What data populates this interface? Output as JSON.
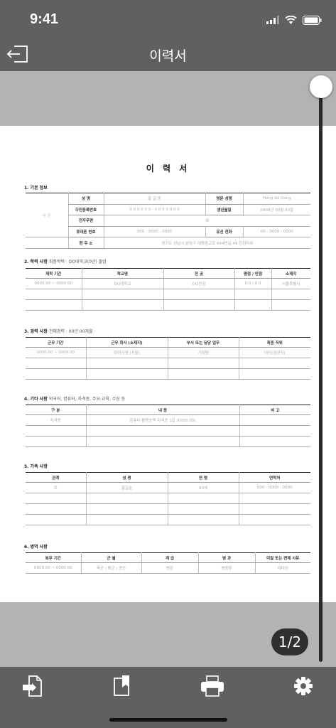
{
  "status": {
    "time": "9:41"
  },
  "nav": {
    "title": "이력서"
  },
  "doc": {
    "title": "이 력 서",
    "basic": {
      "heading": "1. 기본 정보",
      "photo": "사 진",
      "rows": [
        {
          "l1": "성 명",
          "v1": "홍 길 동",
          "l2": "영문 성명",
          "v2": "Hong Gil Dong"
        },
        {
          "l1": "주민등록번호",
          "v1": "0 0 0 0 0 0 - 0 0 0 0 0 0 0",
          "l2": "생년월일",
          "v2": "0000년 00월 00일"
        },
        {
          "l1": "전자우편",
          "v1": "@",
          "l2": "",
          "v2": ""
        },
        {
          "l1": "휴대폰 번호",
          "v1": "000 - 0000 - 0000",
          "l2": "유선 전화",
          "v2": "00 - 0000 - 0000"
        },
        {
          "l1": "현 주 소",
          "v1": "경기도 성남시 분당구 대왕판교로 644번길 49 한컴타워",
          "l2": "",
          "v2": ""
        }
      ]
    },
    "education": {
      "heading": "2. 학력 사항",
      "note": "최종학력 : OO대학교(0년) 졸업",
      "headers": [
        "재학 기간",
        "학교명",
        "전 공",
        "평점 / 만점",
        "소재지"
      ],
      "rows": [
        [
          "0000.00 ~ 0000.00",
          "OO대학교",
          "OO전공",
          "0.0 / 0.0",
          "서울특별시"
        ]
      ]
    },
    "career": {
      "heading": "3. 경력 사항",
      "note": "전체경력 : 00년 00개월",
      "headers": [
        "근무 기간",
        "근무 회사 (소재지)",
        "부서 또는 담당 업무",
        "최종 직위"
      ],
      "rows": [
        [
          "0000.00 ~ 0000.00",
          "㈜회사명 (서울)",
          "기획팀",
          "대리(경과직)"
        ]
      ]
    },
    "others": {
      "heading": "4. 기타 사항",
      "note": "외국어, 컴퓨터, 자격증, 주요 교육, 수상 등",
      "headers": [
        "구 분",
        "내 용",
        "비 고"
      ],
      "rows": [
        [
          "자격증",
          "컴퓨터 활용능력 자격증 1급 (0000.00)",
          ""
        ]
      ]
    },
    "family": {
      "heading": "5. 가족 사항",
      "headers": [
        "관계",
        "성 명",
        "연 령",
        "연락처"
      ],
      "rows": [
        [
          "모",
          "홍길순",
          "00세",
          "000 - 0000 - 0000"
        ]
      ]
    },
    "military": {
      "heading": "6. 병역 사항",
      "headers": [
        "복무 기간",
        "군 별",
        "계 급",
        "병 과",
        "미필 또는 면제 사유"
      ],
      "rows": [
        [
          "0000.00 ~ 0000.00",
          "육군 / 해군 / 공군",
          "병장",
          "병종류",
          "미대상"
        ]
      ]
    }
  },
  "pager": {
    "label": "1/2"
  },
  "icons": {
    "back": "exit-icon",
    "export": "export-file-icon",
    "bookmark": "bookmark-icon",
    "print": "print-icon",
    "settings": "gear-icon"
  }
}
